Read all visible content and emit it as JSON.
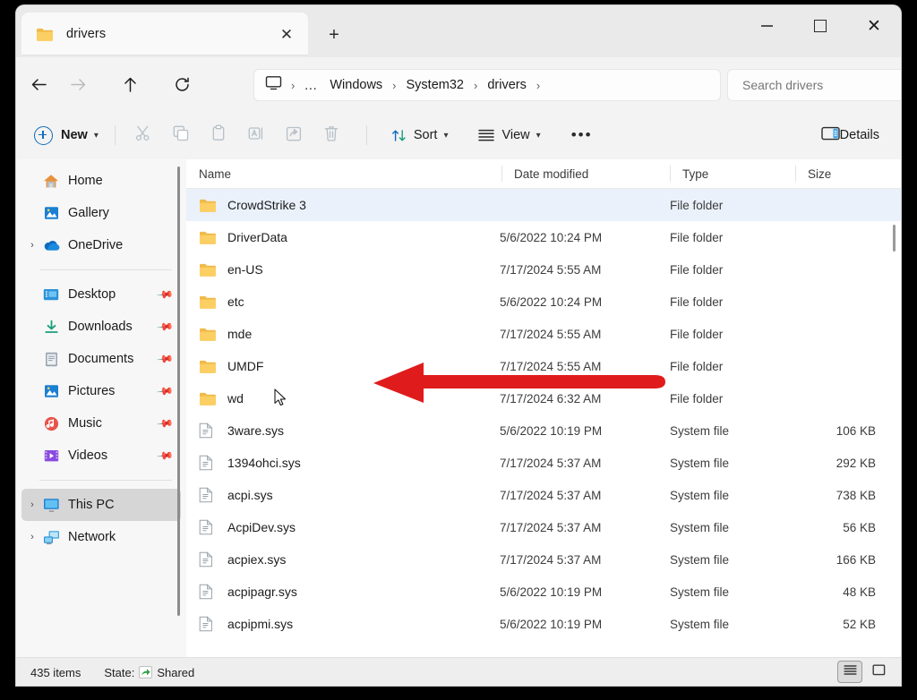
{
  "window": {
    "tab_title": "drivers",
    "tab_close_label": "✕",
    "new_tab_label": "+",
    "minimize_label": "",
    "maximize_label": "",
    "close_label": "✕"
  },
  "address": {
    "back_icon": "back-arrow-icon",
    "forward_icon": "forward-arrow-icon",
    "up_icon": "up-arrow-icon",
    "refresh_icon": "refresh-icon",
    "breadcrumb": [
      {
        "label": "This PC",
        "type": "icon"
      },
      {
        "label": "…",
        "type": "overflow"
      },
      {
        "label": "Windows",
        "type": "crumb"
      },
      {
        "label": "System32",
        "type": "crumb"
      },
      {
        "label": "drivers",
        "type": "crumb"
      }
    ],
    "separator": "›",
    "search_placeholder": "Search drivers",
    "search_value": ""
  },
  "toolbar": {
    "new_label": "New",
    "chevron": "⌄",
    "cut_label": "Cut",
    "copy_label": "Copy",
    "paste_label": "Paste",
    "rename_label": "Rename",
    "share_label": "Share",
    "delete_label": "Delete",
    "sort_label": "Sort",
    "view_label": "View",
    "more_label": "•••",
    "details_label": "Details"
  },
  "sidebar": {
    "items": [
      {
        "label": "Home",
        "icon": "home-icon",
        "expandable": false,
        "pinned": false,
        "selected": false
      },
      {
        "label": "Gallery",
        "icon": "gallery-icon",
        "expandable": false,
        "pinned": false,
        "selected": false
      },
      {
        "label": "OneDrive",
        "icon": "onedrive-icon",
        "expandable": true,
        "pinned": false,
        "selected": false
      },
      {
        "label": "Desktop",
        "icon": "desktop-icon",
        "expandable": false,
        "pinned": true,
        "selected": false
      },
      {
        "label": "Downloads",
        "icon": "downloads-icon",
        "expandable": false,
        "pinned": true,
        "selected": false
      },
      {
        "label": "Documents",
        "icon": "documents-icon",
        "expandable": false,
        "pinned": true,
        "selected": false
      },
      {
        "label": "Pictures",
        "icon": "pictures-icon",
        "expandable": false,
        "pinned": true,
        "selected": false
      },
      {
        "label": "Music",
        "icon": "music-icon",
        "expandable": false,
        "pinned": true,
        "selected": false
      },
      {
        "label": "Videos",
        "icon": "videos-icon",
        "expandable": false,
        "pinned": true,
        "selected": false
      },
      {
        "label": "This PC",
        "icon": "thispc-icon",
        "expandable": true,
        "pinned": false,
        "selected": true
      },
      {
        "label": "Network",
        "icon": "network-icon",
        "expandable": true,
        "pinned": false,
        "selected": false
      }
    ]
  },
  "filelist": {
    "columns": [
      "Name",
      "Date modified",
      "Type",
      "Size"
    ],
    "sort_indicator": "⌃",
    "rows": [
      {
        "name": "CrowdStrike 3",
        "date": "",
        "type": "File folder",
        "size": "",
        "icon": "folder-icon",
        "selected": true
      },
      {
        "name": "DriverData",
        "date": "5/6/2022 10:24 PM",
        "type": "File folder",
        "size": "",
        "icon": "folder-icon",
        "selected": false
      },
      {
        "name": "en-US",
        "date": "7/17/2024 5:55 AM",
        "type": "File folder",
        "size": "",
        "icon": "folder-icon",
        "selected": false
      },
      {
        "name": "etc",
        "date": "5/6/2022 10:24 PM",
        "type": "File folder",
        "size": "",
        "icon": "folder-icon",
        "selected": false
      },
      {
        "name": "mde",
        "date": "7/17/2024 5:55 AM",
        "type": "File folder",
        "size": "",
        "icon": "folder-icon",
        "selected": false
      },
      {
        "name": "UMDF",
        "date": "7/17/2024 5:55 AM",
        "type": "File folder",
        "size": "",
        "icon": "folder-icon",
        "selected": false
      },
      {
        "name": "wd",
        "date": "7/17/2024 6:32 AM",
        "type": "File folder",
        "size": "",
        "icon": "folder-icon",
        "selected": false
      },
      {
        "name": "3ware.sys",
        "date": "5/6/2022 10:19 PM",
        "type": "System file",
        "size": "106 KB",
        "icon": "system-file-icon",
        "selected": false
      },
      {
        "name": "1394ohci.sys",
        "date": "7/17/2024 5:37 AM",
        "type": "System file",
        "size": "292 KB",
        "icon": "system-file-icon",
        "selected": false
      },
      {
        "name": "acpi.sys",
        "date": "7/17/2024 5:37 AM",
        "type": "System file",
        "size": "738 KB",
        "icon": "system-file-icon",
        "selected": false
      },
      {
        "name": "AcpiDev.sys",
        "date": "7/17/2024 5:37 AM",
        "type": "System file",
        "size": "56 KB",
        "icon": "system-file-icon",
        "selected": false
      },
      {
        "name": "acpiex.sys",
        "date": "7/17/2024 5:37 AM",
        "type": "System file",
        "size": "166 KB",
        "icon": "system-file-icon",
        "selected": false
      },
      {
        "name": "acpipagr.sys",
        "date": "5/6/2022 10:19 PM",
        "type": "System file",
        "size": "48 KB",
        "icon": "system-file-icon",
        "selected": false
      },
      {
        "name": "acpipmi.sys",
        "date": "5/6/2022 10:19 PM",
        "type": "System file",
        "size": "52 KB",
        "icon": "system-file-icon",
        "selected": false
      }
    ]
  },
  "statusbar": {
    "item_count": "435 items",
    "state_label": "State:",
    "state_value": "Shared",
    "view_details_icon": "details-view-icon",
    "view_large_icons_icon": "large-icons-view-icon"
  },
  "annotation": {
    "arrow_color": "#e01b1b",
    "arrow_target": "CrowdStrike 3"
  },
  "colors": {
    "accent": "#0f6cbd",
    "selection": "#eaf1fb",
    "folder": "#f5c452",
    "shared_green": "#2f9e44"
  }
}
